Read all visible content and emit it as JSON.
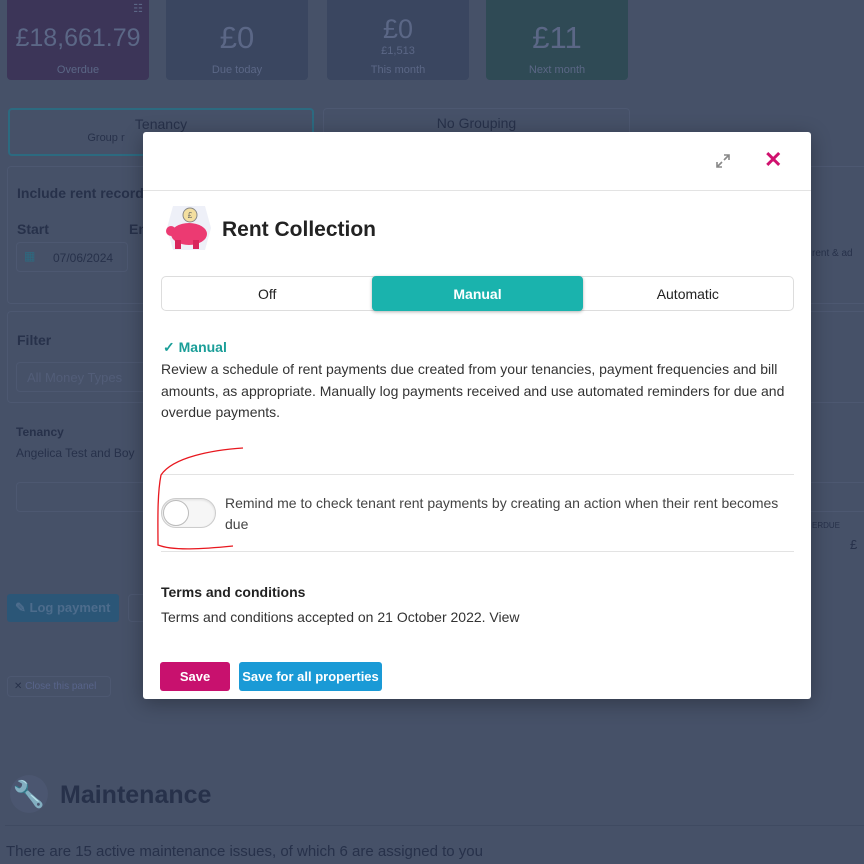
{
  "summary_cards": [
    {
      "amount": "£18,661.79",
      "label": "Overdue",
      "color": "#3c3558"
    },
    {
      "amount": "£0",
      "label": "Due today",
      "color": "#3a4660"
    },
    {
      "amount": "£0",
      "sub": "£1,513",
      "label": "This month",
      "color": "#3a4660"
    },
    {
      "amount": "£11",
      "label": "Next month",
      "color": "#2f4a55"
    }
  ],
  "grouping": {
    "options": [
      "Tenancy",
      "No Grouping"
    ],
    "tenancy_sub": "Group r"
  },
  "date_range": {
    "heading": "Include rent record",
    "start_label": "Start",
    "end_label": "En",
    "start_value": "07/06/2024"
  },
  "filter": {
    "heading": "Filter",
    "placeholder": "All Money Types"
  },
  "tenancy": {
    "label": "Tenancy",
    "value": "Angelica Test and Boy"
  },
  "right_partial": {
    "text1": "rent & ad",
    "overdue_label": "ERDUE",
    "amount": "£"
  },
  "actions": {
    "log_payment": "Log payment",
    "close_panel": "Close this panel"
  },
  "maintenance": {
    "title": "Maintenance",
    "summary": "There are 15 active maintenance issues, of which 6 are assigned to you"
  },
  "modal": {
    "title": "Rent Collection",
    "modes": [
      "Off",
      "Manual",
      "Automatic"
    ],
    "selected_mode": "Manual",
    "selected_heading": "Manual",
    "description": "Review a schedule of rent payments due created from your tenancies, payment frequencies and bill amounts, as appropriate. Manually log payments received and use automated reminders for due and overdue payments.",
    "reminder_toggle": {
      "label": "Remind me to check tenant rent payments by creating an action when their rent becomes due",
      "on": false
    },
    "terms_heading": "Terms and conditions",
    "terms_text": "Terms and conditions accepted on 21 October 2022. View",
    "save_label": "Save",
    "save_all_label": "Save for all properties",
    "colors": {
      "accent": "#1ab3ad",
      "save": "#c8116e",
      "save_all": "#1a9ad6",
      "close": "#d0116e"
    }
  }
}
